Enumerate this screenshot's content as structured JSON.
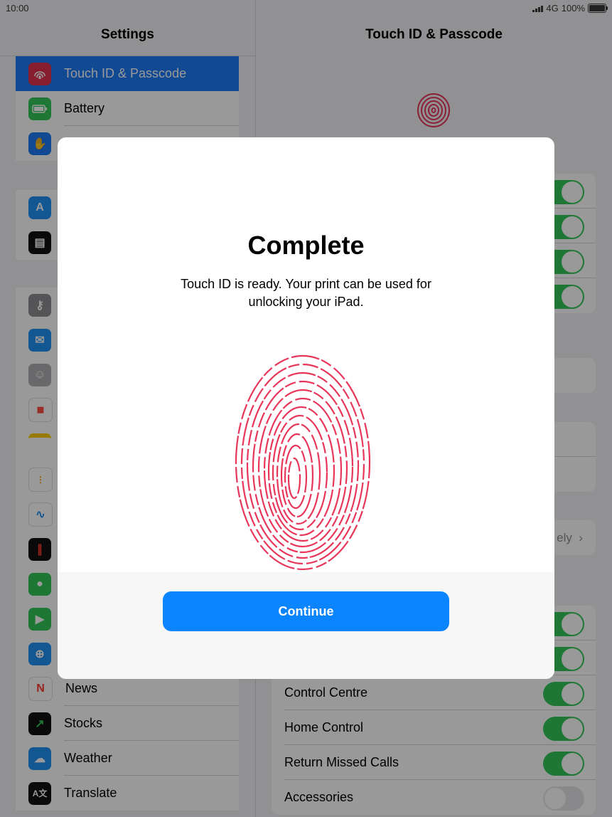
{
  "status_bar": {
    "time": "10:00",
    "network": "4G",
    "battery": "100%"
  },
  "sidebar": {
    "title": "Settings",
    "items": [
      {
        "label": "Touch ID & Passcode",
        "icon": "fingerprint-icon",
        "color": "#e0334d",
        "selected": true
      },
      {
        "label": "Battery",
        "icon": "battery-icon",
        "color": "#34c759"
      },
      {
        "label": "",
        "icon": "hand-icon",
        "color": "#1f7bf6"
      },
      {
        "label": "",
        "icon": "app-store-icon",
        "color": "#1f8ff3"
      },
      {
        "label": "",
        "icon": "wallet-icon",
        "color": "#111111"
      },
      {
        "label": "",
        "icon": "key-icon",
        "color": "#8e8e93"
      },
      {
        "label": "",
        "icon": "mail-icon",
        "color": "#1f8ff3"
      },
      {
        "label": "",
        "icon": "contacts-icon",
        "color": "#b0b0b5"
      },
      {
        "label": "",
        "icon": "calendar-icon",
        "color": "#ff3b30"
      },
      {
        "label": "",
        "icon": "notes-icon",
        "color": "#ffcc00"
      },
      {
        "label": "",
        "icon": "reminders-icon",
        "color": "#ffffff"
      },
      {
        "label": "",
        "icon": "freeform-icon",
        "color": "#ffffff"
      },
      {
        "label": "",
        "icon": "voice-memos-icon",
        "color": "#111111"
      },
      {
        "label": "",
        "icon": "messages-icon",
        "color": "#34c759"
      },
      {
        "label": "",
        "icon": "facetime-icon",
        "color": "#34c759"
      },
      {
        "label": "",
        "icon": "safari-icon",
        "color": "#1f8ff3"
      },
      {
        "label": "News",
        "icon": "news-icon",
        "color": "#ff3b30"
      },
      {
        "label": "Stocks",
        "icon": "stocks-icon",
        "color": "#111111"
      },
      {
        "label": "Weather",
        "icon": "weather-icon",
        "color": "#1f8ff3"
      },
      {
        "label": "Translate",
        "icon": "translate-icon",
        "color": "#111111"
      }
    ]
  },
  "detail": {
    "title": "Touch ID & Passcode",
    "partial_row_trailing": "ely",
    "allow_access_rows": [
      {
        "label": "",
        "on": true
      },
      {
        "label": "",
        "on": true
      },
      {
        "label": "Control Centre",
        "on": true
      },
      {
        "label": "Home Control",
        "on": true
      },
      {
        "label": "Return Missed Calls",
        "on": true
      },
      {
        "label": "Accessories",
        "on": false
      }
    ]
  },
  "modal": {
    "title": "Complete",
    "body": "Touch ID is ready. Your print can be used for unlocking your iPad.",
    "fingerprint_color": "#e8365a",
    "continue_label": "Continue",
    "button_color": "#0a84ff"
  }
}
